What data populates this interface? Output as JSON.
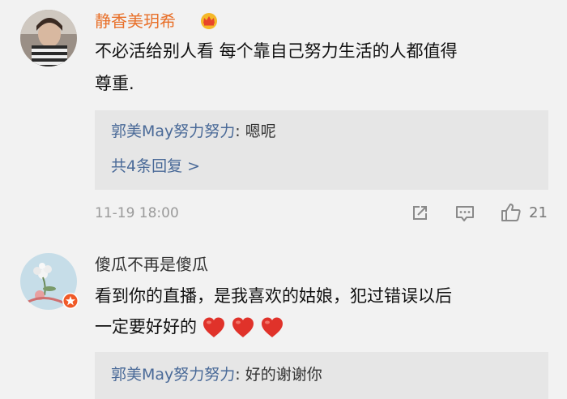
{
  "comments": [
    {
      "username": "静香美玥希",
      "username_color": "#e8702a",
      "badge_icon": "crown-icon",
      "content_line1": "不必活给别人看 每个靠自己努力生活的人都值得",
      "content_line2": "尊重.",
      "reply": {
        "author": "郭美May努力努力",
        "separator": ":",
        "text": " 嗯呢"
      },
      "more_replies": "共4条回复 >",
      "time": "11-19 18:00",
      "actions": [
        "share-icon",
        "comment-icon",
        "like-icon"
      ],
      "like_count": "21"
    },
    {
      "username": "傻瓜不再是傻瓜",
      "username_color": "#333333",
      "badge_icon": "weibo-badge-icon",
      "content_line1": "看到你的直播，是我喜欢的姑娘，犯过错误以后",
      "content_line2": "一定要好好的",
      "content_emoji": [
        "heart-icon",
        "heart-icon",
        "heart-icon"
      ],
      "reply": {
        "author": "郭美May努力努力",
        "separator": ":",
        "text": " 好的谢谢你"
      }
    }
  ],
  "colors": {
    "background": "#f2f2f2",
    "reply_background": "#e6e6e6",
    "link_blue": "#4a6a98",
    "heart_red": "#e0322a"
  }
}
